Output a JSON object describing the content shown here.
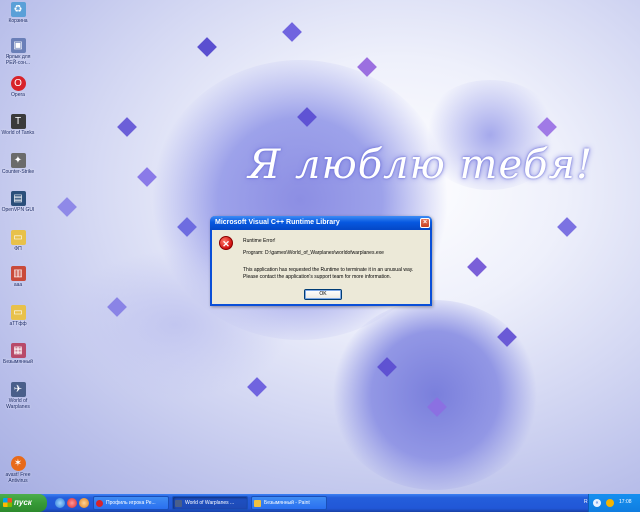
{
  "desktop": {
    "wallpaper_text": "Я люблю тебя!",
    "icons": [
      {
        "label": "Корзина",
        "icon": "recycle-bin-icon",
        "color": "#5aa0d8",
        "glyph": "♻"
      },
      {
        "label": "Ярлык для РЕЙ-сон...",
        "icon": "shortcut-icon",
        "color": "#6a7fb8",
        "glyph": "▣"
      },
      {
        "label": "Opera",
        "icon": "opera-icon",
        "color": "#d8232a",
        "glyph": "O"
      },
      {
        "label": "World of Tanks",
        "icon": "world-of-tanks-icon",
        "color": "#3b3b3b",
        "glyph": "T"
      },
      {
        "label": "Counter-Strike",
        "icon": "counter-strike-icon",
        "color": "#6b6b6b",
        "glyph": "✦"
      },
      {
        "label": "OpenVPN GUI",
        "icon": "openvpn-icon",
        "color": "#2b4f7a",
        "glyph": "▤"
      },
      {
        "label": "ФП",
        "icon": "folder-icon",
        "color": "#e8c14a",
        "glyph": "▭"
      },
      {
        "label": "ааа",
        "icon": "document-icon",
        "color": "#c94a3a",
        "glyph": "▥"
      },
      {
        "label": "аТТфф",
        "icon": "folder-icon",
        "color": "#e8c14a",
        "glyph": "▭"
      },
      {
        "label": "Безымянный",
        "icon": "paint-image-icon",
        "color": "#b84a6a",
        "glyph": "▦"
      },
      {
        "label": "World of Warplanes",
        "icon": "world-of-warplanes-icon",
        "color": "#4a5f8a",
        "glyph": "✈"
      },
      {
        "label": "avast! Free Antivirus",
        "icon": "avast-icon",
        "color": "#e86a1a",
        "glyph": "✶"
      }
    ]
  },
  "dialog": {
    "title": "Microsoft Visual C++ Runtime Library",
    "close_label": "×",
    "heading": "Runtime Error!",
    "program_line": "Program: D:\\games\\World_of_Warplanes\\worldofwarplanes.exe",
    "message_line1": "This application has requested the Runtime to terminate it in an unusual way.",
    "message_line2": "Please contact the application's support team for more information.",
    "ok_label": "OK",
    "error_glyph": "✕"
  },
  "taskbar": {
    "start_label": "пуск",
    "tasks": [
      {
        "label": "Профиль игрока Ре...",
        "icon": "opera-icon",
        "color": "#d8232a",
        "active": false
      },
      {
        "label": "World of Warplanes ...",
        "icon": "world-of-warplanes-icon",
        "color": "#4a5f8a",
        "active": true
      },
      {
        "label": "Безымянный - Paint",
        "icon": "paint-icon",
        "color": "#f0c040",
        "active": false
      }
    ],
    "tray": {
      "language": "RU",
      "arrow": "«",
      "clock": "17:08"
    }
  }
}
